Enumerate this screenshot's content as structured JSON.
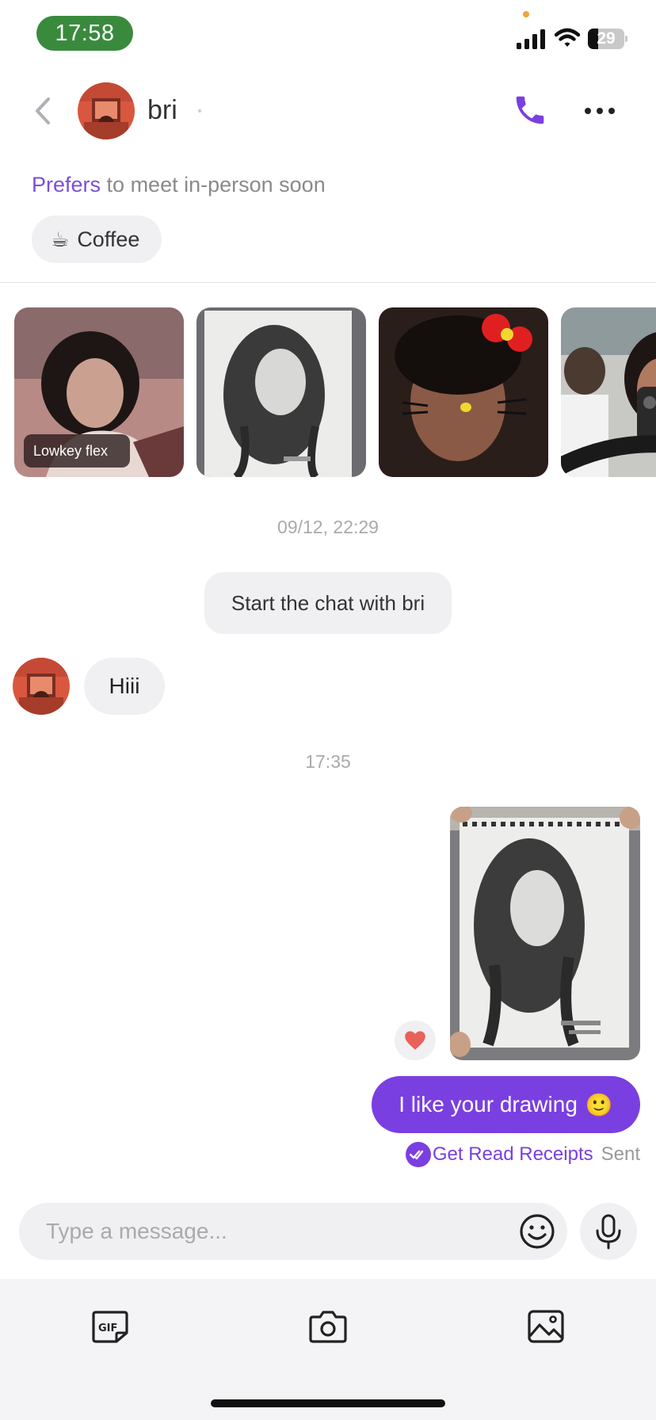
{
  "status_bar": {
    "time": "17:58",
    "battery_level": "29",
    "battery_fraction": 0.29
  },
  "header": {
    "contact_name": "bri"
  },
  "preference": {
    "accent": "Prefers",
    "text": "to meet in-person soon",
    "chip_icon": "☕",
    "chip_label": "Coffee"
  },
  "photos": [
    {
      "name": "photo-selfie",
      "label": "Lowkey flex"
    },
    {
      "name": "photo-sketch",
      "label": ""
    },
    {
      "name": "photo-filter-selfie",
      "label": ""
    },
    {
      "name": "photo-mirror-selfie",
      "label": ""
    }
  ],
  "chat": {
    "timestamp_1": "09/12, 22:29",
    "system_message": "Start the chat with bri",
    "incoming_message": "Hiii",
    "timestamp_2": "17:35",
    "outgoing_message": "I like your drawing",
    "outgoing_emoji": "🙂",
    "read_receipts_link": "Get Read Receipts",
    "sent_status": "Sent"
  },
  "composer": {
    "placeholder": "Type a message..."
  },
  "colors": {
    "accent": "#7a3fe0",
    "time_pill": "#3a8a3e",
    "bubble_gray": "#f0f0f3",
    "heart": "#e8615a"
  },
  "icons": [
    "back-chevron-icon",
    "phone-icon",
    "more-dots-icon",
    "smiley-icon",
    "microphone-icon",
    "gif-icon",
    "camera-icon",
    "image-icon",
    "heart-icon",
    "double-check-icon"
  ]
}
